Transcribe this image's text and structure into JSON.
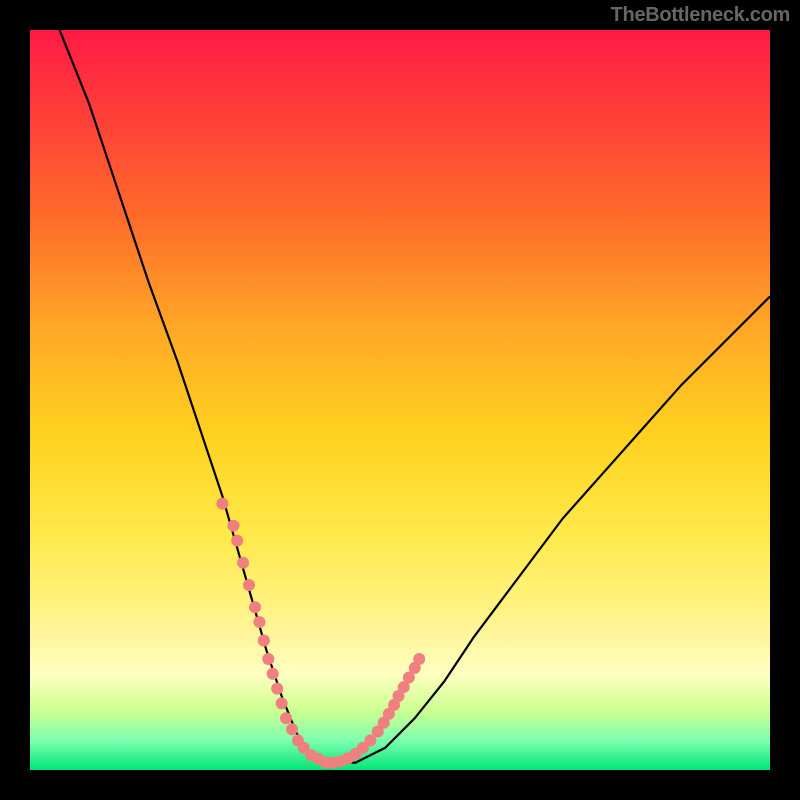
{
  "watermark": "TheBottleneck.com",
  "colors": {
    "frame": "#000000",
    "curve": "#000000",
    "dots": "#f08080",
    "gradient_top": "#ff1a44",
    "gradient_bottom": "#00e676"
  },
  "chart_data": {
    "type": "line",
    "title": "",
    "xlabel": "",
    "ylabel": "",
    "xlim": [
      0,
      100
    ],
    "ylim": [
      0,
      100
    ],
    "series": [
      {
        "name": "bottleneck-curve",
        "x": [
          4,
          8,
          12,
          16,
          20,
          24,
          26,
          28,
          30,
          32,
          34,
          36,
          38,
          40,
          44,
          48,
          52,
          56,
          60,
          66,
          72,
          80,
          88,
          96,
          100
        ],
        "y": [
          100,
          90,
          78,
          66,
          55,
          43,
          37,
          30,
          23,
          16,
          10,
          5,
          2,
          1,
          1,
          3,
          7,
          12,
          18,
          26,
          34,
          43,
          52,
          60,
          64
        ]
      }
    ],
    "highlight_points": {
      "name": "dot-markers",
      "x": [
        26,
        27.5,
        28,
        28.8,
        29.6,
        30.4,
        31,
        31.6,
        32.2,
        32.8,
        33.4,
        34,
        34.6,
        35.4,
        36.2,
        37,
        38,
        39,
        40,
        41,
        42,
        43,
        44,
        45,
        46,
        47,
        47.8,
        48.5,
        49.2,
        49.8,
        50.5,
        51.2,
        52,
        52.6
      ],
      "y": [
        36,
        33,
        31,
        28,
        25,
        22,
        20,
        17.5,
        15,
        13,
        11,
        9,
        7,
        5.5,
        4,
        3,
        2,
        1.5,
        1,
        1,
        1.2,
        1.6,
        2.2,
        3,
        4,
        5.2,
        6.4,
        7.6,
        8.8,
        10,
        11.2,
        12.5,
        13.8,
        15
      ]
    },
    "green_band_y_range": [
      0,
      3
    ]
  }
}
